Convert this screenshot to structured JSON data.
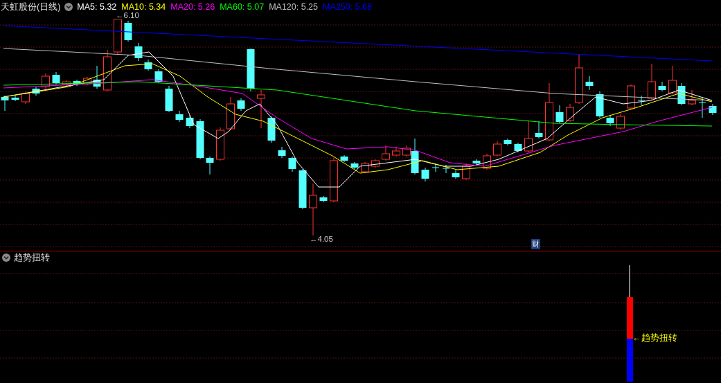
{
  "header": {
    "title": "天虹股份(日线)",
    "indicators": [
      {
        "label": "MA5: 5.32",
        "color": "#ffffff"
      },
      {
        "label": "MA10: 5.34",
        "color": "#ffff00"
      },
      {
        "label": "MA20: 5.26",
        "color": "#ff00ff"
      },
      {
        "label": "MA60: 5.07",
        "color": "#00ff00"
      },
      {
        "label": "MA120: 5.25",
        "color": "#c0c0c0"
      },
      {
        "label": "MA250: 5.68",
        "color": "#0000ff"
      }
    ]
  },
  "main_chart": {
    "high_label": "←6.10",
    "low_label": "←4.05",
    "event_marker": "财"
  },
  "sub_chart": {
    "title": "趋势扭转",
    "signal_label": "←趋势扭转"
  }
}
